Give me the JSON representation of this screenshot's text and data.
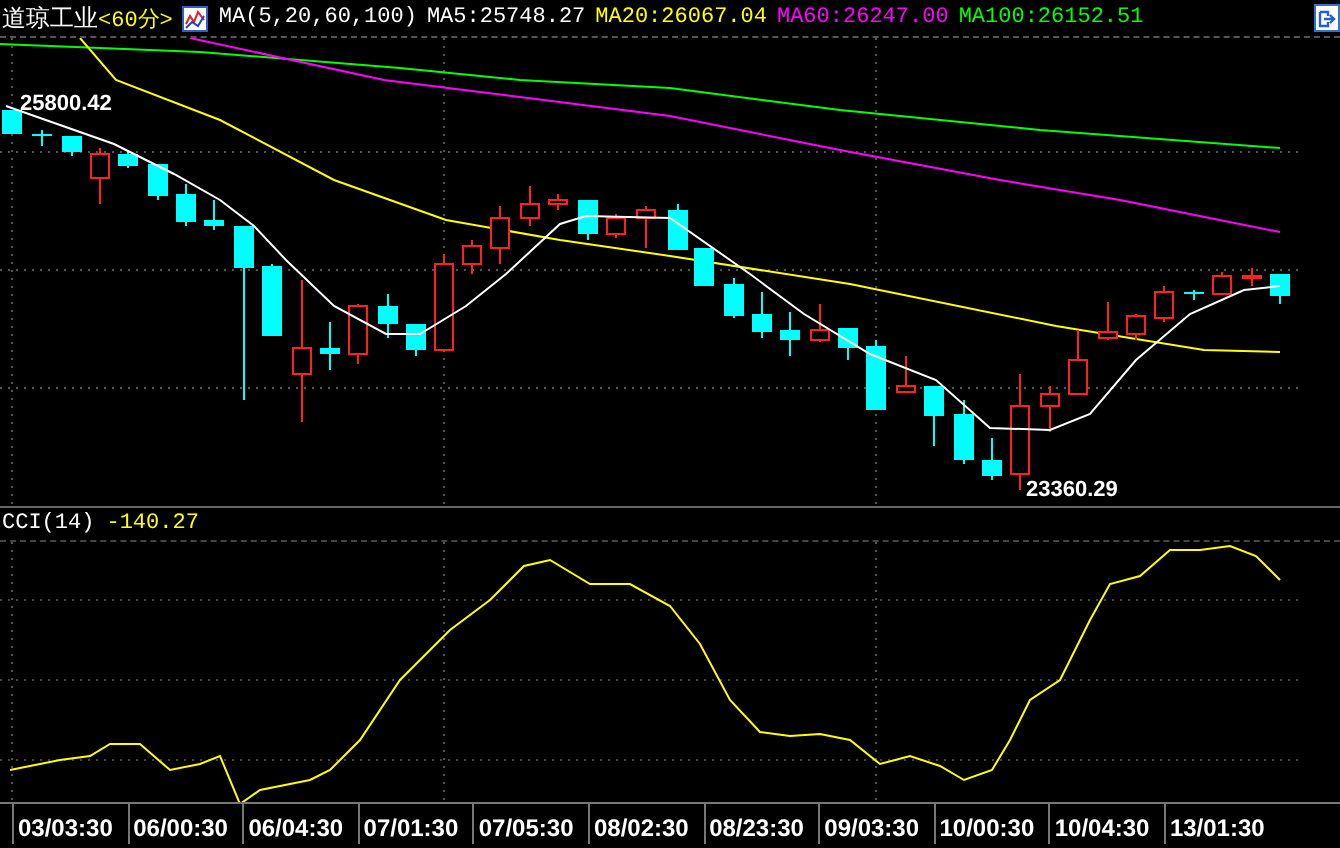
{
  "header": {
    "title": "道琼工业",
    "period": "<60分>",
    "indicator": "MA(5,20,60,100)",
    "ma_values": [
      {
        "label": "MA5:25748.27",
        "color": "#ffffff"
      },
      {
        "label": "MA20:26067.04",
        "color": "#ffff00"
      },
      {
        "label": "MA60:26247.00",
        "color": "#ff00ff"
      },
      {
        "label": "MA100:26152.51",
        "color": "#00ff00"
      }
    ]
  },
  "main_chart": {
    "high_label": "25800.42",
    "low_label": "23360.29"
  },
  "cci": {
    "label": "CCI(14)",
    "value": "-140.27"
  },
  "time_axis": [
    "03/03:30",
    "06/00:30",
    "06/04:30",
    "07/01:30",
    "07/05:30",
    "08/02:30",
    "08/23:30",
    "09/03:30",
    "10/00:30",
    "10/04:30",
    "13/01:30"
  ]
}
